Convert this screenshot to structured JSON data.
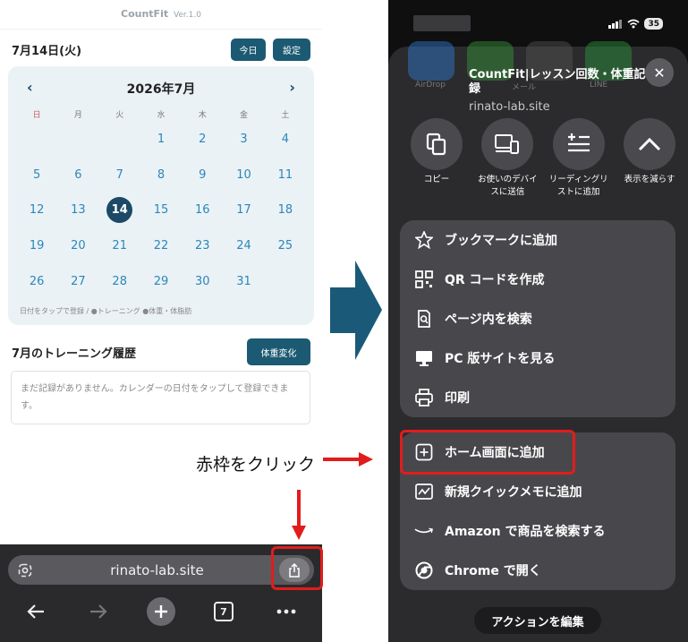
{
  "left": {
    "app_name": "CountFit",
    "version": "Ver.1.0",
    "date": "7月14日(火)",
    "today_button": "今日",
    "settings_button": "設定",
    "calendar": {
      "prev": "‹",
      "next": "›",
      "month_title": "2026年7月",
      "weekdays": [
        "日",
        "月",
        "火",
        "水",
        "木",
        "金",
        "土"
      ],
      "days": [
        "",
        "",
        "",
        "1",
        "2",
        "3",
        "4",
        "5",
        "6",
        "7",
        "8",
        "9",
        "10",
        "11",
        "12",
        "13",
        "14",
        "15",
        "16",
        "17",
        "18",
        "19",
        "20",
        "21",
        "22",
        "23",
        "24",
        "25",
        "26",
        "27",
        "28",
        "29",
        "30",
        "31",
        ""
      ],
      "today": "14",
      "note": "日付をタップで登録 / ●トレーニング ●体重・体脂肪"
    },
    "history_title": "7月のトレーニング履歴",
    "weight_button": "体重変化",
    "history_empty": "まだ記録がありません。カレンダーの日付をタップして登録できます。"
  },
  "instruction": "赤枠をクリック",
  "browser": {
    "url": "rinato-lab.site",
    "tab_count": "7"
  },
  "share_sheet": {
    "ghost_labels": [
      "AirDrop",
      "メール",
      "LINE"
    ],
    "page_title": "CountFit|レッスン回数・体重記録",
    "domain": "rinato-lab.site",
    "close_icon": "✕",
    "status_battery": "35",
    "quick_actions": [
      {
        "label": "コピー",
        "icon": "copy-icon"
      },
      {
        "label": "お使いのデバイスに送信",
        "icon": "send-to-device-icon"
      },
      {
        "label": "リーディングリストに追加",
        "icon": "reading-list-icon"
      },
      {
        "label": "表示を減らす",
        "icon": "chevron-up-icon"
      }
    ],
    "group1": [
      {
        "label": "ブックマークに追加",
        "icon": "star-icon"
      },
      {
        "label": "QR コードを作成",
        "icon": "qr-code-icon"
      },
      {
        "label": "ページ内を検索",
        "icon": "find-in-page-icon"
      },
      {
        "label": "PC 版サイトを見る",
        "icon": "desktop-icon"
      },
      {
        "label": "印刷",
        "icon": "print-icon"
      }
    ],
    "group2": [
      {
        "label": "ホーム画面に追加",
        "icon": "add-square-icon"
      },
      {
        "label": "新規クイックメモに追加",
        "icon": "quick-note-icon"
      },
      {
        "label": "Amazon で商品を検索する",
        "icon": "amazon-icon"
      },
      {
        "label": "Chrome で開く",
        "icon": "chrome-icon"
      }
    ],
    "edit_actions": "アクションを編集"
  },
  "colors": {
    "accent": "#1c5a73",
    "day_text": "#2d86b8",
    "highlight_red": "#e21c1c",
    "big_arrow": "#1a5a78"
  }
}
